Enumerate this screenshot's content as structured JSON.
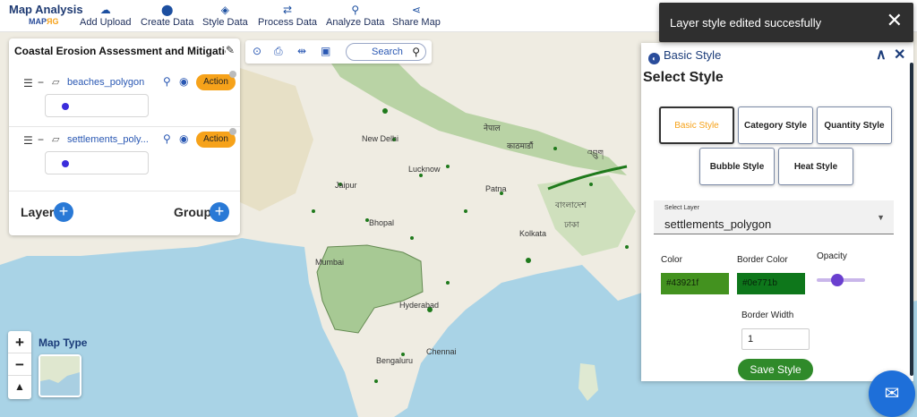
{
  "brand": {
    "title": "Map Analysis",
    "sub_prefix": "MAP",
    "sub_suffix": "ЯG"
  },
  "nav": [
    {
      "label": "Add Upload",
      "icon": "cloud-upload-icon"
    },
    {
      "label": "Create Data",
      "icon": "map-pin-icon"
    },
    {
      "label": "Style Data",
      "icon": "paint-bucket-icon"
    },
    {
      "label": "Process Data",
      "icon": "process-icon"
    },
    {
      "label": "Analyze Data",
      "icon": "analyze-icon"
    },
    {
      "label": "Share Map",
      "icon": "share-icon"
    }
  ],
  "toast": {
    "message": "Layer style edited succesfully",
    "close": "✕"
  },
  "layer_panel": {
    "title": "Coastal Erosion Assessment and Mitigation",
    "layers": [
      {
        "name": "beaches_polygon",
        "action": "Action"
      },
      {
        "name": "settlements_poly...",
        "action": "Action"
      }
    ],
    "layer_label": "Layer",
    "group_label": "Group"
  },
  "map_tools": {
    "search_placeholder": "Search"
  },
  "map_type": {
    "label": "Map Type"
  },
  "map_labels": {
    "delhi": "New Delhi",
    "jaipur": "Jaipur",
    "lucknow": "Lucknow",
    "patna": "Patna",
    "kolkata": "Kolkata",
    "bhopal": "Bhopal",
    "hyderabad": "Hyderabad",
    "bengaluru": "Bengaluru",
    "chennai": "Chennai",
    "kathmandu": "काठमाडौं",
    "bangladesh": "বাংলাদেশ",
    "nepal": "नेपाल",
    "bhutan": "འབྲུག",
    "dhaka": "ঢাকা",
    "mumbai": "Mumbai"
  },
  "style_panel": {
    "header": "Basic Style",
    "collapse": "∧",
    "close": "✕",
    "title": "Select Style",
    "style_buttons": [
      {
        "label": "Basic Style",
        "active": true
      },
      {
        "label": "Category Style",
        "active": false
      },
      {
        "label": "Quantity Style",
        "active": false
      },
      {
        "label": "Bubble Style",
        "active": false
      },
      {
        "label": "Heat Style",
        "active": false
      }
    ],
    "select_layer_label": "Select Layer",
    "select_layer_value": "settlements_polygon",
    "color_label": "Color",
    "color_value": "#43921f",
    "border_color_label": "Border Color",
    "border_color_value": "#0e771b",
    "opacity_label": "Opacity",
    "opacity_value": 0.4,
    "border_width_label": "Border Width",
    "border_width_value": "1",
    "save_label": "Save Style"
  },
  "colors": {
    "accent": "#f6a21a",
    "brand": "#1e3a72",
    "save_green": "#2f8a2a",
    "fill_color": "#43921f",
    "border_color": "#0e771b"
  }
}
